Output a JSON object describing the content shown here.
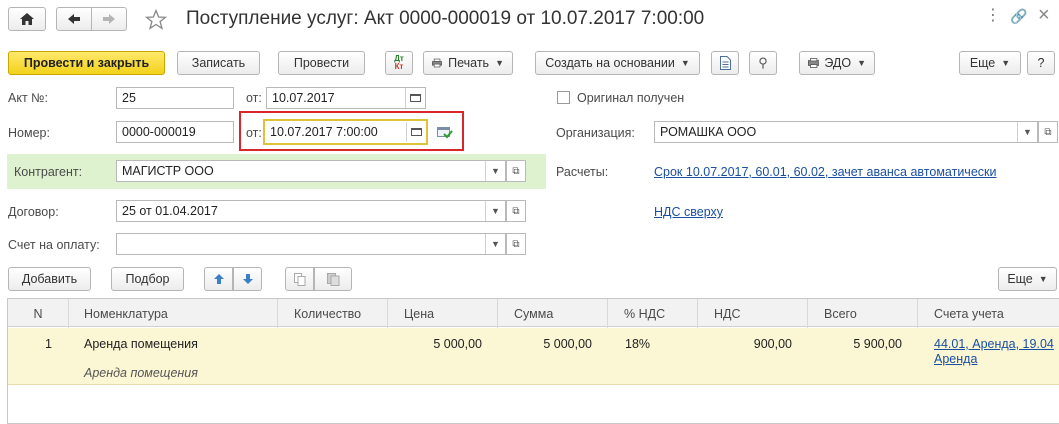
{
  "titlebar": {
    "title": "Поступление услуг: Акт 0000-000019 от 10.07.2017 7:00:00",
    "home_icon": "home-icon",
    "back_icon": "arrow-left-icon",
    "forward_icon": "arrow-right-icon",
    "favorite_icon": "star-icon",
    "menu_icon": "more-vertical-icon",
    "link_icon": "link-icon",
    "close_icon": "close-icon"
  },
  "toolbar": {
    "post_and_close": "Провести и закрыть",
    "save": "Записать",
    "post": "Провести",
    "dt_kt_line1": "Дт",
    "dt_kt_line2": "Кт",
    "print": "Печать",
    "create_based_on": "Создать на основании",
    "edo": "ЭДО",
    "more": "Еще",
    "help": "?"
  },
  "form": {
    "akt_label": "Акт №:",
    "akt_value": "25",
    "akt_date_label": "от:",
    "akt_date_value": "10.07.2017",
    "number_label": "Номер:",
    "number_value": "0000-000019",
    "number_date_label": "от:",
    "number_date_value": "10.07.2017  7:00:00",
    "counterparty_label": "Контрагент:",
    "counterparty_value": "МАГИСТР ООО",
    "contract_label": "Договор:",
    "contract_value": "25 от 01.04.2017",
    "invoice_label": "Счет на оплату:",
    "invoice_value": "",
    "original_received_label": "Оригинал получен",
    "original_received_checked": false,
    "organization_label": "Организация:",
    "organization_value": "РОМАШКА ООО",
    "settlements_label": "Расчеты:",
    "settlements_link": "Срок 10.07.2017, 60.01, 60.02, зачет аванса автоматически",
    "vat_link": "НДС сверху"
  },
  "table_toolbar": {
    "add": "Добавить",
    "selection": "Подбор",
    "more": "Еще"
  },
  "table": {
    "columns": [
      "N",
      "Номенклатура",
      "Количество",
      "Цена",
      "Сумма",
      "% НДС",
      "НДС",
      "Всего",
      "Счета учета"
    ],
    "rows": [
      {
        "n": "1",
        "nomenclature": "Аренда помещения",
        "nomenclature_sub": "Аренда помещения",
        "quantity": "",
        "price": "5 000,00",
        "sum": "5 000,00",
        "vat_rate": "18%",
        "vat": "900,00",
        "total": "5 900,00",
        "accounts_line1": "44.01, Аренда, 19.04",
        "accounts_line2": "Аренда"
      }
    ]
  },
  "colors": {
    "primary_button": "#f3d11a",
    "highlight_red": "#d9262b",
    "active_field_border": "#e0c23a",
    "counterparty_bg": "#dff2d0",
    "row_selected_bg": "#fbf6d4",
    "link": "#1a4fa0"
  }
}
